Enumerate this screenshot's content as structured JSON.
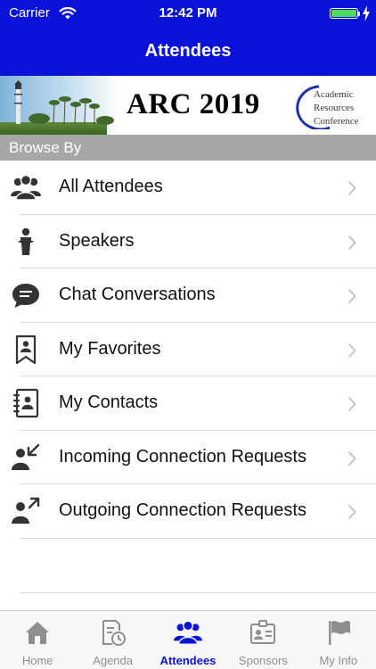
{
  "status_bar": {
    "carrier": "Carrier",
    "time": "12:42 PM",
    "battery_level": 1.0
  },
  "nav": {
    "title": "Attendees"
  },
  "banner": {
    "title": "ARC 2019",
    "logo_lines": [
      "Academic",
      "Resources",
      "Conference"
    ]
  },
  "section": {
    "label": "Browse By"
  },
  "list": {
    "items": [
      {
        "label": "All Attendees",
        "icon": "group-icon"
      },
      {
        "label": "Speakers",
        "icon": "podium-speaker-icon"
      },
      {
        "label": "Chat Conversations",
        "icon": "chat-bubble-icon"
      },
      {
        "label": "My Favorites",
        "icon": "bookmarked-person-icon"
      },
      {
        "label": "My Contacts",
        "icon": "address-book-icon"
      },
      {
        "label": "Incoming Connection Requests",
        "icon": "person-incoming-arrow-icon"
      },
      {
        "label": "Outgoing Connection Requests",
        "icon": "person-outgoing-arrow-icon"
      }
    ]
  },
  "tabs": [
    {
      "label": "Home",
      "icon": "home-icon",
      "active": false
    },
    {
      "label": "Agenda",
      "icon": "agenda-calendar-clock-icon",
      "active": false
    },
    {
      "label": "Attendees",
      "icon": "group-icon",
      "active": true
    },
    {
      "label": "Sponsors",
      "icon": "badge-card-icon",
      "active": false
    },
    {
      "label": "My Info",
      "icon": "flag-icon",
      "active": false
    }
  ],
  "colors": {
    "brand_blue": "#0b12d8",
    "section_gray": "#a7a7a7",
    "icon_dark": "#333333",
    "tab_inactive": "#8e8e8e",
    "battery_green": "#4cd964"
  }
}
